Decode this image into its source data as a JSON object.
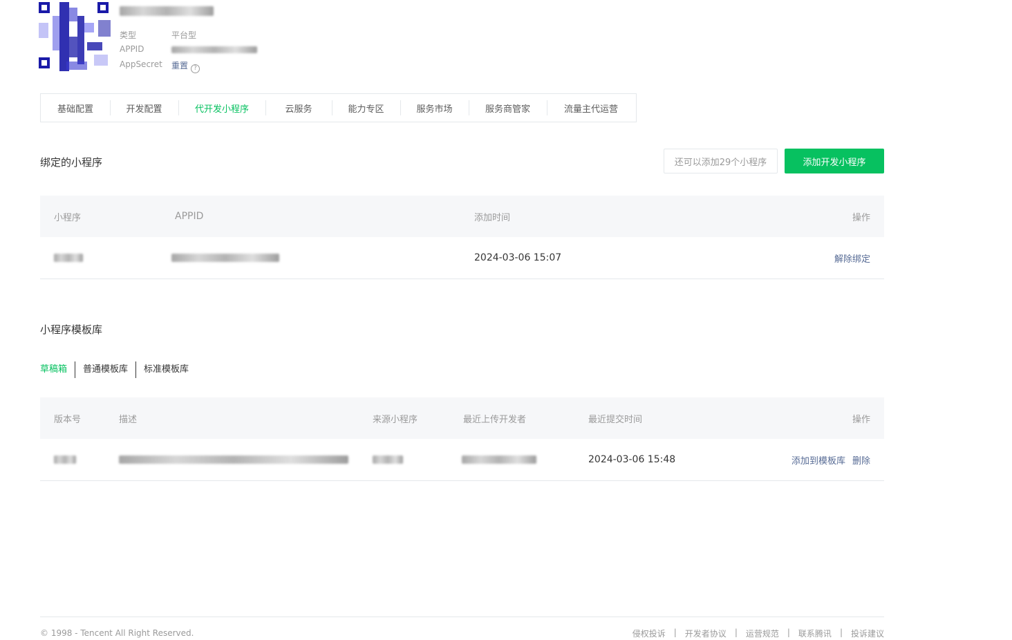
{
  "account": {
    "type_label": "类型",
    "type_value": "平台型",
    "appid_label": "APPID",
    "appsecret_label": "AppSecret",
    "reset_label": "重置",
    "help_glyph": "?"
  },
  "tabs": [
    {
      "label": "基础配置",
      "active": false
    },
    {
      "label": "开发配置",
      "active": false
    },
    {
      "label": "代开发小程序",
      "active": true
    },
    {
      "label": "云服务",
      "active": false
    },
    {
      "label": "能力专区",
      "active": false
    },
    {
      "label": "服务市场",
      "active": false
    },
    {
      "label": "服务商管家",
      "active": false
    },
    {
      "label": "流量主代运营",
      "active": false
    }
  ],
  "bound": {
    "title": "绑定的小程序",
    "quota_text": "还可以添加29个小程序",
    "add_button": "添加开发小程序",
    "columns": {
      "name": "小程序",
      "appid": "APPID",
      "added_time": "添加时间",
      "action": "操作"
    },
    "rows": [
      {
        "added_time": "2024-03-06 15:07",
        "action": "解除绑定"
      }
    ]
  },
  "templates": {
    "title": "小程序模板库",
    "subtabs": [
      {
        "label": "草稿箱",
        "active": true
      },
      {
        "label": "普通模板库",
        "active": false
      },
      {
        "label": "标准模板库",
        "active": false
      }
    ],
    "columns": {
      "version": "版本号",
      "desc": "描述",
      "source": "来源小程序",
      "uploader": "最近上传开发者",
      "submit_time": "最近提交时间",
      "action": "操作"
    },
    "rows": [
      {
        "submit_time": "2024-03-06 15:48",
        "add_action": "添加到模板库",
        "delete_action": "删除"
      }
    ]
  },
  "footer": {
    "copyright": "© 1998 - Tencent All Right Reserved.",
    "links": [
      "侵权投诉",
      "开发者协议",
      "运营规范",
      "联系腾讯",
      "投诉建议"
    ],
    "separator": "|"
  },
  "colors": {
    "accent": "#07c160",
    "link": "#576b95",
    "muted": "#9a9a9a",
    "text": "#353535",
    "qr": "#1a1aa8"
  }
}
